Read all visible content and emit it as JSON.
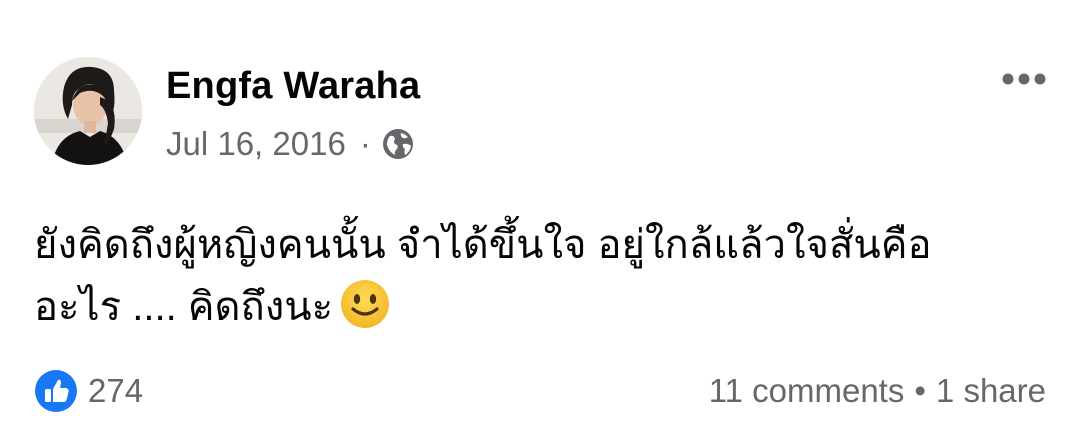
{
  "post": {
    "author": "Engfa Waraha",
    "date": "Jul 16, 2016",
    "separator": "·",
    "audience_icon": "globe-icon",
    "text_line1": "ยังคิดถึงผู้หญิงคนนั้น จำได้ขึ้นใจ อยู่ใกล้แล้วใจสั่นคือ",
    "text_line2": "อะไร .... คิดถึงนะ",
    "emoji": "slightly-smiling-face",
    "more_icon": "more-horizontal-icon"
  },
  "footer": {
    "reaction_icon": "like-icon",
    "reaction_count": "274",
    "comments": "11 comments",
    "separator": "•",
    "shares": "1 share"
  },
  "colors": {
    "text_primary": "#050505",
    "text_secondary": "#65676b",
    "like_blue": "#1877f2",
    "emoji_yellow": "#f7c33a"
  }
}
